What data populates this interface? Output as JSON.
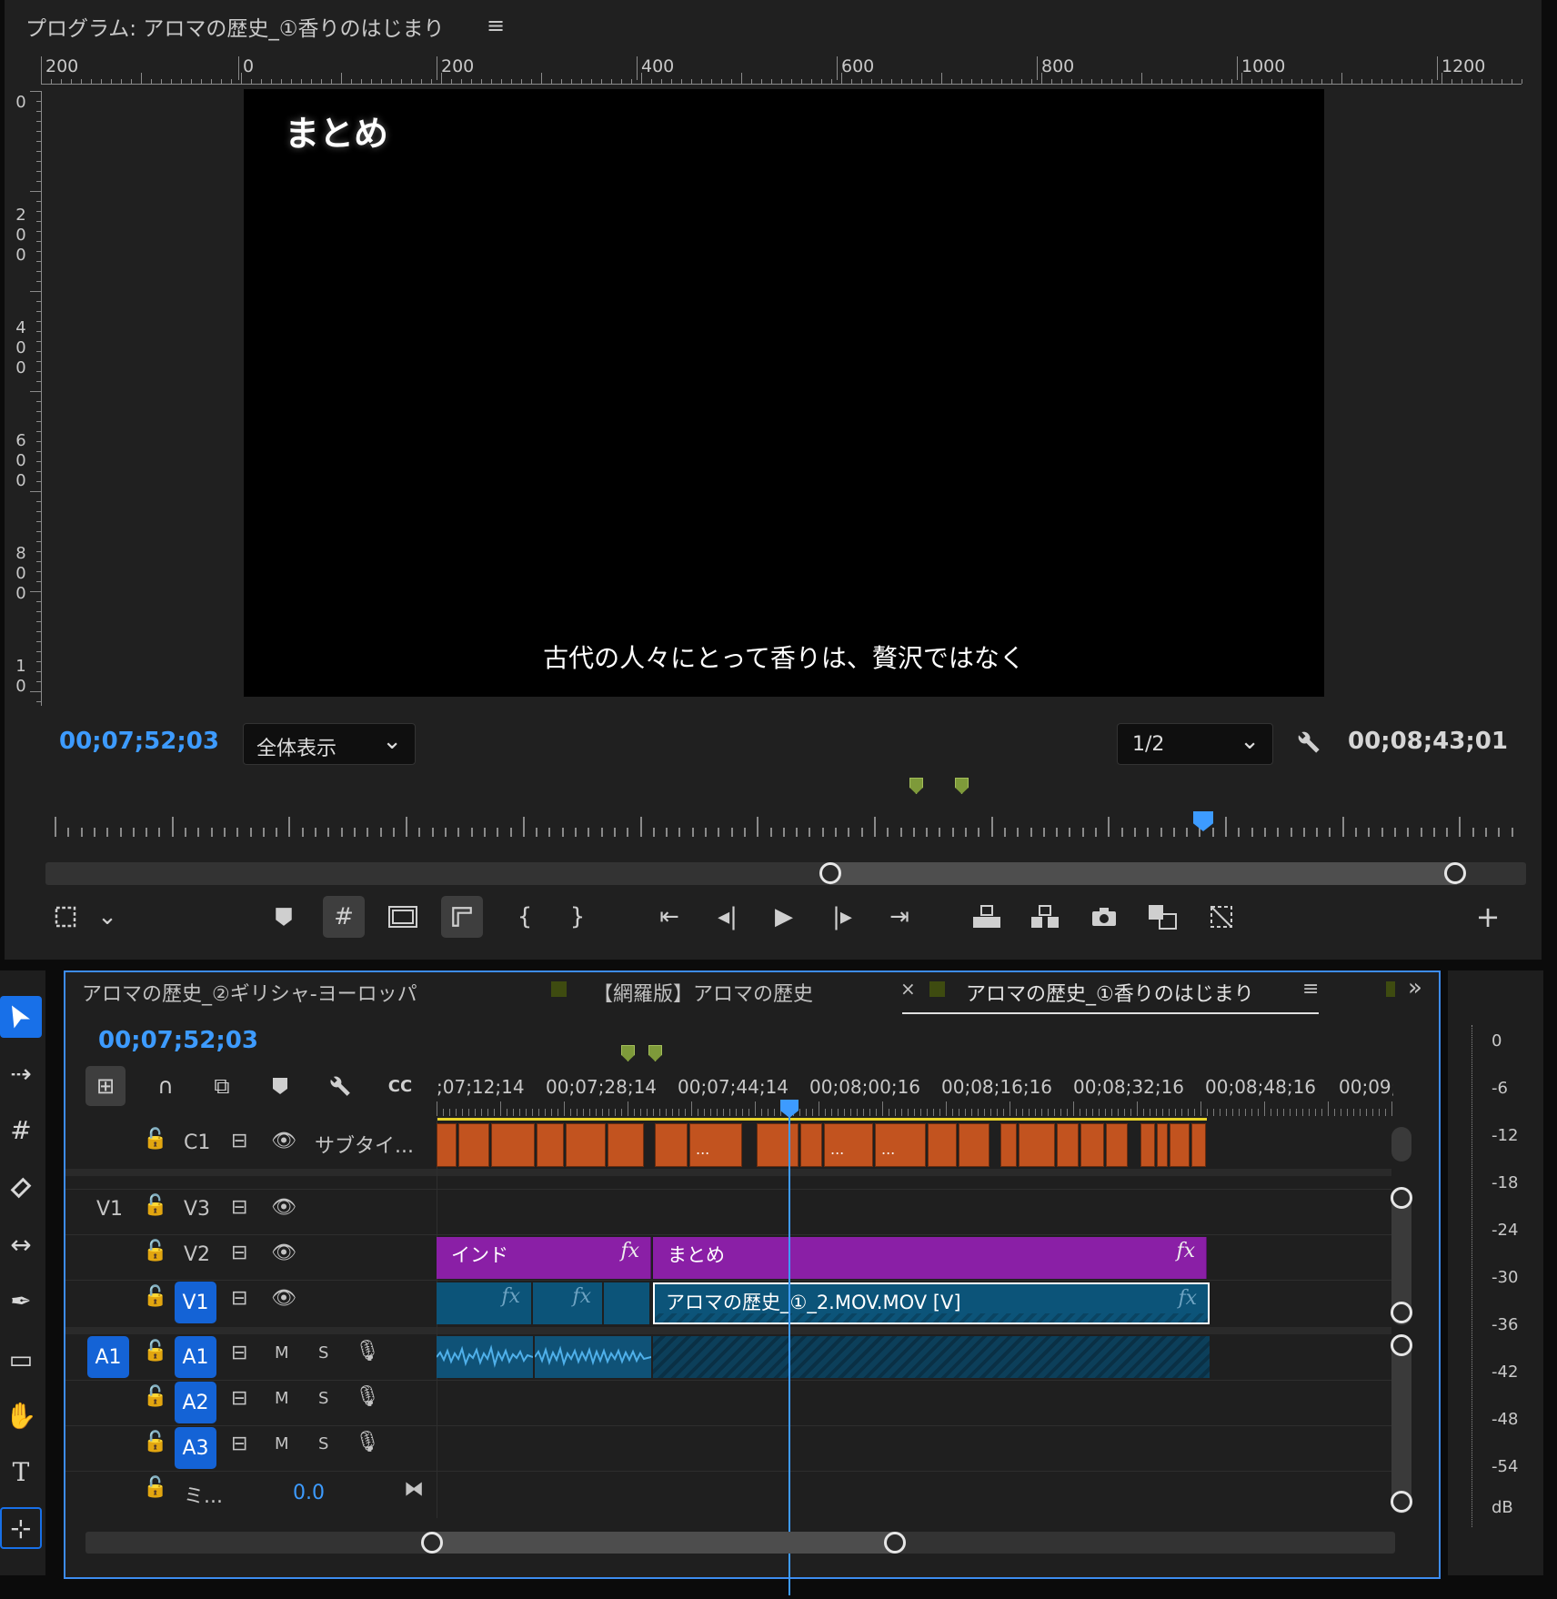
{
  "program_monitor": {
    "title": "プログラム: アロマの歴史_①香りのはじまり",
    "menu_icon": "≡",
    "ruler_h_labels": [
      "200",
      "0",
      "200",
      "400",
      "600",
      "800",
      "1000",
      "1200"
    ],
    "ruler_v_labels": [
      "0",
      "2\n0\n0",
      "4\n0\n0",
      "6\n0\n0",
      "8\n0\n0",
      "1\n0"
    ],
    "frame_title": "まとめ",
    "frame_subtitle": "古代の人々にとって香りは、贅沢ではなく",
    "current_timecode": "00;07;52;03",
    "fit_dropdown": "全体表示",
    "resolution_dropdown": "1/2",
    "duration_timecode": "00;08;43;01"
  },
  "transport_buttons": {
    "add": "+"
  },
  "timeline": {
    "tabs": [
      {
        "label": "アロマの歴史_②ギリシャ-ヨーロッパ"
      },
      {
        "label": "【網羅版】アロマの歴史"
      },
      {
        "label": "アロマの歴史_①香りのはじまり",
        "active": true
      }
    ],
    "tab_close": "×",
    "tab_menu": "≡",
    "tab_overflow": "»",
    "current_timecode": "00;07;52;03",
    "ruler_labels": [
      ";07;12;14",
      "00;07;28;14",
      "00;07;44;14",
      "00;08;00;16",
      "00;08;16;16",
      "00;08;32;16",
      "00;08;48;16",
      "00;09;("
    ],
    "tracks": {
      "c1": {
        "label": "C1",
        "name": "サブタイ..."
      },
      "v3": {
        "src": "V1",
        "label": "V3"
      },
      "v2": {
        "label": "V2"
      },
      "v1": {
        "label": "V1"
      },
      "a1": {
        "src": "A1",
        "label": "A1",
        "m": "M",
        "s": "S"
      },
      "a2": {
        "label": "A2",
        "m": "M",
        "s": "S"
      },
      "a3": {
        "label": "A3",
        "m": "M",
        "s": "S"
      },
      "mix": {
        "label": "ミ...",
        "value": "0.0"
      }
    },
    "caption_dots": "...",
    "clips": {
      "v2_ind": "インド",
      "v2_matome": "まとめ",
      "v1_main": "アロマの歴史_①_2.MOV.MOV [V]",
      "fx": "fx"
    }
  },
  "meter": {
    "labels": [
      "0",
      "-6",
      "-12",
      "-18",
      "-24",
      "-30",
      "-36",
      "-42",
      "-48",
      "-54",
      "dB"
    ]
  },
  "colors": {
    "accent": "#3d9bff",
    "caption_clip": "#c2531f",
    "graphic_clip": "#8a1fa6",
    "video_clip": "#0c5479",
    "active_track": "#1463d6"
  }
}
